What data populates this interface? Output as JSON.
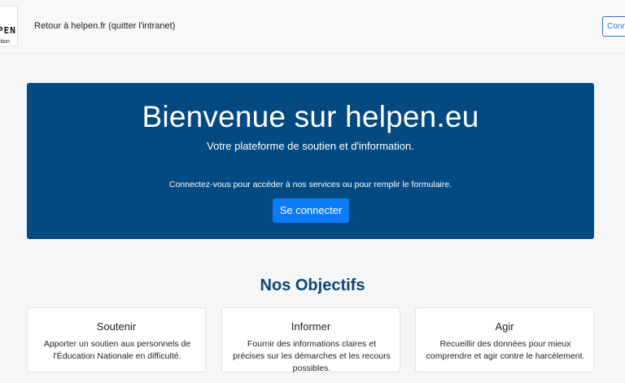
{
  "header": {
    "logo_text": "PEN",
    "logo_subtext": "stion",
    "back_link": "Retour à helpen.fr (quitter l'intranet)",
    "top_button": "Conne"
  },
  "hero": {
    "title": "Bienvenue sur helpen.eu",
    "subtitle": "Votre plateforme de soutien et d'information.",
    "text": "Connectez-vous pour accéder à nos services ou pour remplir le formulaire.",
    "button": "Se connecter"
  },
  "objectives": {
    "title": "Nos Objectifs",
    "cards": [
      {
        "title": "Soutenir",
        "text": "Apporter un soutien aux personnels de l'Éducation Nationale en difficulté."
      },
      {
        "title": "Informer",
        "text": "Fournir des informations claires et précises sur les démarches et les recours possibles."
      },
      {
        "title": "Agir",
        "text": "Recueillir des données pour mieux comprendre et agir contre le harcèlement."
      }
    ]
  },
  "colors": {
    "hero_bg": "#034a82",
    "accent": "#0d7bf5",
    "heading": "#0b4677"
  }
}
